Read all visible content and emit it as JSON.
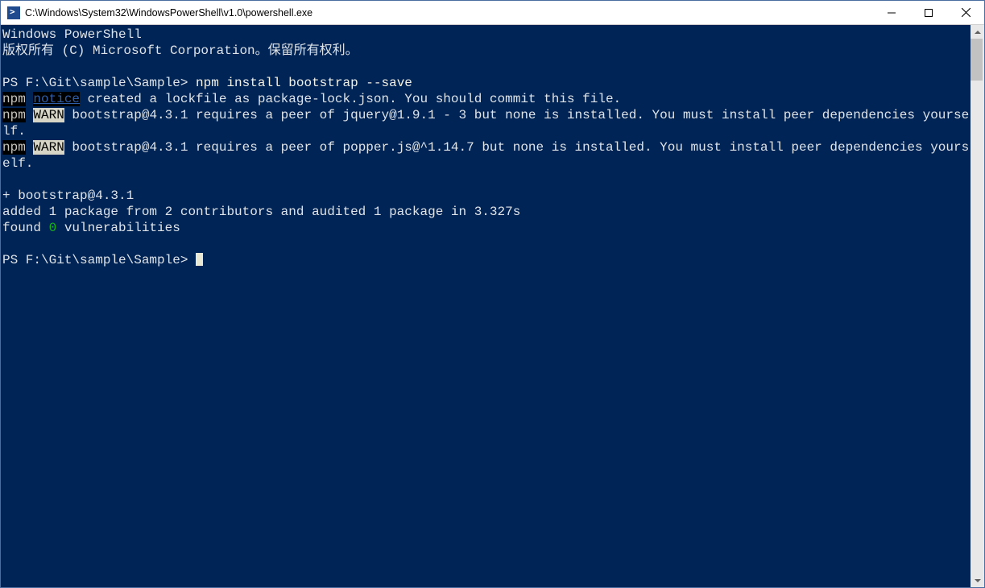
{
  "titlebar": {
    "title": "C:\\Windows\\System32\\WindowsPowerShell\\v1.0\\powershell.exe"
  },
  "terminal": {
    "header1": "Windows PowerShell",
    "header2": "版权所有 (C) Microsoft Corporation。保留所有权利。",
    "prompt1_path": "PS F:\\Git\\sample\\Sample> ",
    "prompt1_cmd": "npm install bootstrap --save",
    "line_npm1_a": "npm",
    "line_npm1_b": " ",
    "line_npm1_c": "notice",
    "line_npm1_d": " created a lockfile as package-lock.json. You should commit this file.",
    "line_npm2_a": "npm",
    "line_npm2_b": " ",
    "line_npm2_c": "WARN",
    "line_npm2_d": " bootstrap@4.3.1 requires a peer of jquery@1.9.1 - 3 but none is installed. You must install peer dependencies yourself.",
    "line_npm3_a": "npm",
    "line_npm3_b": " ",
    "line_npm3_c": "WARN",
    "line_npm3_d": " bootstrap@4.3.1 requires a peer of popper.js@^1.14.7 but none is installed. You must install peer dependencies yourself.",
    "blank": "",
    "line_plus": "+ bootstrap@4.3.1",
    "line_added": "added 1 package from 2 contributors and audited 1 package in 3.327s",
    "line_found_a": "found ",
    "line_found_b": "0",
    "line_found_c": " vulnerabilities",
    "prompt2_path": "PS F:\\Git\\sample\\Sample> "
  }
}
